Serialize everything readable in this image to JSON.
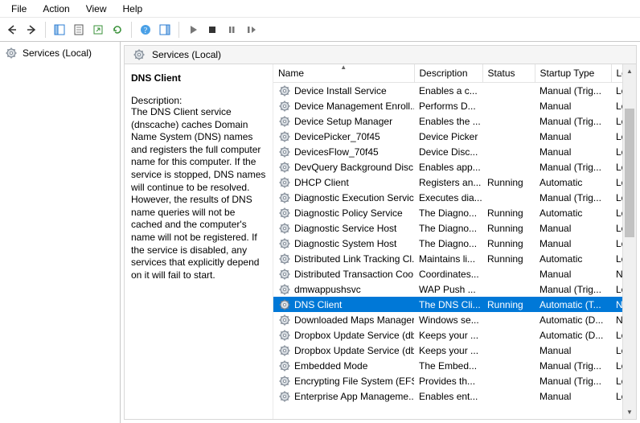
{
  "menu": {
    "items": [
      "File",
      "Action",
      "View",
      "Help"
    ]
  },
  "toolbar": {
    "icons": [
      "back",
      "forward",
      "show-hide-tree",
      "properties",
      "export",
      "refresh",
      "help",
      "show-hide-action",
      "start",
      "stop",
      "pause",
      "restart"
    ]
  },
  "left_nav": {
    "root": "Services (Local)"
  },
  "pane": {
    "title": "Services (Local)"
  },
  "detail": {
    "name": "DNS Client",
    "desc_label": "Description:",
    "desc_text": "The DNS Client service (dnscache) caches Domain Name System (DNS) names and registers the full computer name for this computer. If the service is stopped, DNS names will continue to be resolved. However, the results of DNS name queries will not be cached and the computer's name will not be registered. If the service is disabled, any services that explicitly depend on it will fail to start."
  },
  "columns": [
    "Name",
    "Description",
    "Status",
    "Startup Type",
    "Log"
  ],
  "sort_col": 0,
  "selected_index": 13,
  "services": [
    {
      "name": "Device Install Service",
      "desc": "Enables a c...",
      "status": "",
      "startup": "Manual (Trig...",
      "logon": "Loc"
    },
    {
      "name": "Device Management Enroll...",
      "desc": "Performs D...",
      "status": "",
      "startup": "Manual",
      "logon": "Loc"
    },
    {
      "name": "Device Setup Manager",
      "desc": "Enables the ...",
      "status": "",
      "startup": "Manual (Trig...",
      "logon": "Loc"
    },
    {
      "name": "DevicePicker_70f45",
      "desc": "Device Picker",
      "status": "",
      "startup": "Manual",
      "logon": "Loc"
    },
    {
      "name": "DevicesFlow_70f45",
      "desc": "Device Disc...",
      "status": "",
      "startup": "Manual",
      "logon": "Loc"
    },
    {
      "name": "DevQuery Background Disc...",
      "desc": "Enables app...",
      "status": "",
      "startup": "Manual (Trig...",
      "logon": "Loc"
    },
    {
      "name": "DHCP Client",
      "desc": "Registers an...",
      "status": "Running",
      "startup": "Automatic",
      "logon": "Loc"
    },
    {
      "name": "Diagnostic Execution Service",
      "desc": "Executes dia...",
      "status": "",
      "startup": "Manual (Trig...",
      "logon": "Loc"
    },
    {
      "name": "Diagnostic Policy Service",
      "desc": "The Diagno...",
      "status": "Running",
      "startup": "Automatic",
      "logon": "Loc"
    },
    {
      "name": "Diagnostic Service Host",
      "desc": "The Diagno...",
      "status": "Running",
      "startup": "Manual",
      "logon": "Loc"
    },
    {
      "name": "Diagnostic System Host",
      "desc": "The Diagno...",
      "status": "Running",
      "startup": "Manual",
      "logon": "Loc"
    },
    {
      "name": "Distributed Link Tracking Cl...",
      "desc": "Maintains li...",
      "status": "Running",
      "startup": "Automatic",
      "logon": "Loc"
    },
    {
      "name": "Distributed Transaction Coo...",
      "desc": "Coordinates...",
      "status": "",
      "startup": "Manual",
      "logon": "Net"
    },
    {
      "name": "dmwappushsvc",
      "desc": "WAP Push ...",
      "status": "",
      "startup": "Manual (Trig...",
      "logon": "Loc"
    },
    {
      "name": "DNS Client",
      "desc": "The DNS Cli...",
      "status": "Running",
      "startup": "Automatic (T...",
      "logon": "Net"
    },
    {
      "name": "Downloaded Maps Manager",
      "desc": "Windows se...",
      "status": "",
      "startup": "Automatic (D...",
      "logon": "Net"
    },
    {
      "name": "Dropbox Update Service (db...",
      "desc": "Keeps your ...",
      "status": "",
      "startup": "Automatic (D...",
      "logon": "Loc"
    },
    {
      "name": "Dropbox Update Service (db...",
      "desc": "Keeps your ...",
      "status": "",
      "startup": "Manual",
      "logon": "Loc"
    },
    {
      "name": "Embedded Mode",
      "desc": "The Embed...",
      "status": "",
      "startup": "Manual (Trig...",
      "logon": "Loc"
    },
    {
      "name": "Encrypting File System (EFS)",
      "desc": "Provides th...",
      "status": "",
      "startup": "Manual (Trig...",
      "logon": "Loc"
    },
    {
      "name": "Enterprise App Manageme...",
      "desc": "Enables ent...",
      "status": "",
      "startup": "Manual",
      "logon": "Loc"
    }
  ]
}
